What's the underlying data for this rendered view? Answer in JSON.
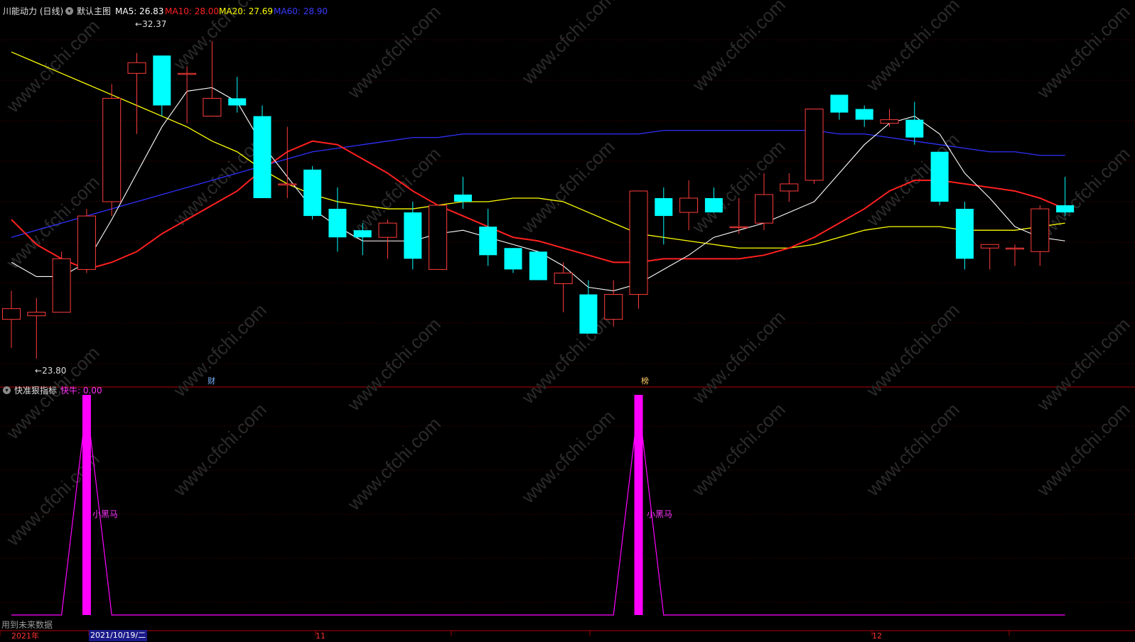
{
  "header": {
    "stock_title": "川能动力 (日线)",
    "main_chart_label": "默认主图",
    "ma5": "MA5: 26.83",
    "ma10": "MA10: 28.00",
    "ma20": "MA20: 27.69",
    "ma60": "MA60: 28.90"
  },
  "indicator_header": {
    "name": "快准狠指标",
    "value": "快牛: 0.00"
  },
  "annotations": {
    "high_price": "32.37",
    "low_price": "23.80",
    "event_cai": "财",
    "event_bang": "榜",
    "signal_label": "小黑马"
  },
  "footer": {
    "future_data_note": "用到未来数据",
    "year_label": "2021年",
    "selected_date": "2021/10/19/二",
    "month_11": "11",
    "month_12": "12"
  },
  "watermark": "www.cfchi.com",
  "colors": {
    "background": "#000000",
    "up": "#ff3c3c",
    "down": "#00ffff",
    "ma5": "#ffffff",
    "ma10": "#ff2020",
    "ma20": "#ffff00",
    "ma60": "#3030ff",
    "signal": "#ff00ff",
    "divider": "#b00000"
  },
  "chart_data": {
    "type": "candlestick",
    "price_range": [
      23.3,
      33.3
    ],
    "candles": [
      {
        "o": 24.9,
        "h": 25.7,
        "l": 24.1,
        "c": 25.2
      },
      {
        "o": 25.0,
        "h": 25.5,
        "l": 23.8,
        "c": 25.1
      },
      {
        "o": 25.1,
        "h": 26.8,
        "l": 25.1,
        "c": 26.6
      },
      {
        "o": 26.3,
        "h": 28.0,
        "l": 26.2,
        "c": 27.8
      },
      {
        "o": 28.2,
        "h": 31.5,
        "l": 27.8,
        "c": 31.1
      },
      {
        "o": 31.8,
        "h": 32.37,
        "l": 30.1,
        "c": 32.1
      },
      {
        "o": 32.3,
        "h": 32.3,
        "l": 30.6,
        "c": 30.9
      },
      {
        "o": 31.8,
        "h": 32.0,
        "l": 30.4,
        "c": 31.8
      },
      {
        "o": 30.6,
        "h": 32.7,
        "l": 30.7,
        "c": 31.1
      },
      {
        "o": 31.1,
        "h": 31.7,
        "l": 30.7,
        "c": 30.9
      },
      {
        "o": 30.6,
        "h": 30.9,
        "l": 28.3,
        "c": 28.3
      },
      {
        "o": 28.7,
        "h": 30.3,
        "l": 28.3,
        "c": 28.7
      },
      {
        "o": 29.1,
        "h": 29.2,
        "l": 27.7,
        "c": 27.8
      },
      {
        "o": 28.0,
        "h": 28.6,
        "l": 26.8,
        "c": 27.2
      },
      {
        "o": 27.4,
        "h": 27.6,
        "l": 26.7,
        "c": 27.2
      },
      {
        "o": 27.2,
        "h": 27.7,
        "l": 26.6,
        "c": 27.6
      },
      {
        "o": 27.9,
        "h": 28.2,
        "l": 26.3,
        "c": 26.6
      },
      {
        "o": 26.3,
        "h": 28.1,
        "l": 26.3,
        "c": 28.1
      },
      {
        "o": 28.4,
        "h": 28.9,
        "l": 28.0,
        "c": 28.2
      },
      {
        "o": 27.5,
        "h": 28.0,
        "l": 26.4,
        "c": 26.7
      },
      {
        "o": 26.9,
        "h": 26.9,
        "l": 26.2,
        "c": 26.3
      },
      {
        "o": 26.8,
        "h": 26.8,
        "l": 26.0,
        "c": 26.0
      },
      {
        "o": 25.9,
        "h": 26.5,
        "l": 25.1,
        "c": 26.2
      },
      {
        "o": 25.6,
        "h": 26.0,
        "l": 24.5,
        "c": 24.5
      },
      {
        "o": 24.9,
        "h": 26.0,
        "l": 24.7,
        "c": 25.6
      },
      {
        "o": 25.6,
        "h": 28.5,
        "l": 25.2,
        "c": 28.5
      },
      {
        "o": 28.3,
        "h": 28.6,
        "l": 27.0,
        "c": 27.8
      },
      {
        "o": 27.9,
        "h": 28.8,
        "l": 27.4,
        "c": 28.3
      },
      {
        "o": 28.3,
        "h": 28.6,
        "l": 27.9,
        "c": 27.9
      },
      {
        "o": 27.5,
        "h": 28.3,
        "l": 27.3,
        "c": 27.5
      },
      {
        "o": 27.6,
        "h": 29.0,
        "l": 27.4,
        "c": 28.4
      },
      {
        "o": 28.5,
        "h": 29.0,
        "l": 28.2,
        "c": 28.7
      },
      {
        "o": 28.8,
        "h": 30.5,
        "l": 28.7,
        "c": 30.8
      },
      {
        "o": 31.2,
        "h": 31.2,
        "l": 30.5,
        "c": 30.7
      },
      {
        "o": 30.8,
        "h": 30.9,
        "l": 30.3,
        "c": 30.5
      },
      {
        "o": 30.4,
        "h": 30.8,
        "l": 30.3,
        "c": 30.5
      },
      {
        "o": 30.5,
        "h": 31.0,
        "l": 29.8,
        "c": 30.0
      },
      {
        "o": 29.6,
        "h": 29.6,
        "l": 28.1,
        "c": 28.2
      },
      {
        "o": 28.0,
        "h": 28.2,
        "l": 26.3,
        "c": 26.6
      },
      {
        "o": 26.9,
        "h": 27.0,
        "l": 26.3,
        "c": 27.0
      },
      {
        "o": 26.9,
        "h": 27.0,
        "l": 26.4,
        "c": 26.9
      },
      {
        "o": 26.8,
        "h": 28.1,
        "l": 26.4,
        "c": 28.0
      },
      {
        "o": 28.1,
        "h": 28.9,
        "l": 27.8,
        "c": 27.9
      }
    ],
    "ma5": [
      26.5,
      26.1,
      26.1,
      26.5,
      27.7,
      29.0,
      30.3,
      31.3,
      31.4,
      31.0,
      29.8,
      28.9,
      28.0,
      27.5,
      27.1,
      27.1,
      27.1,
      27.3,
      27.4,
      27.2,
      27.0,
      26.8,
      26.4,
      25.8,
      25.7,
      25.9,
      26.3,
      26.7,
      27.2,
      27.4,
      27.6,
      27.9,
      28.2,
      29.0,
      29.8,
      30.4,
      30.6,
      30.1,
      29.0,
      28.3,
      27.5,
      27.2,
      27.1
    ],
    "ma10": [
      27.7,
      27.0,
      26.6,
      26.3,
      26.5,
      26.8,
      27.3,
      27.7,
      28.1,
      28.5,
      29.1,
      29.6,
      29.9,
      29.8,
      29.4,
      29.0,
      28.5,
      28.1,
      27.8,
      27.5,
      27.2,
      27.1,
      26.9,
      26.7,
      26.5,
      26.5,
      26.6,
      26.6,
      26.6,
      26.6,
      26.7,
      26.9,
      27.2,
      27.6,
      28.0,
      28.5,
      28.8,
      28.8,
      28.7,
      28.6,
      28.5,
      28.3,
      28.0
    ],
    "ma20": [
      32.4,
      32.1,
      31.8,
      31.5,
      31.2,
      30.9,
      30.6,
      30.3,
      29.9,
      29.6,
      29.1,
      28.7,
      28.4,
      28.2,
      28.1,
      28.0,
      28.0,
      28.1,
      28.2,
      28.2,
      28.3,
      28.3,
      28.2,
      27.9,
      27.6,
      27.3,
      27.2,
      27.1,
      27.0,
      26.9,
      26.9,
      26.9,
      27.0,
      27.2,
      27.4,
      27.5,
      27.5,
      27.5,
      27.4,
      27.4,
      27.4,
      27.5,
      27.6
    ],
    "ma60": [
      27.2,
      27.4,
      27.6,
      27.8,
      28.0,
      28.2,
      28.4,
      28.6,
      28.8,
      29.0,
      29.2,
      29.4,
      29.6,
      29.7,
      29.8,
      29.9,
      30.0,
      30.0,
      30.1,
      30.1,
      30.1,
      30.1,
      30.1,
      30.1,
      30.1,
      30.1,
      30.2,
      30.2,
      30.2,
      30.2,
      30.2,
      30.2,
      30.2,
      30.1,
      30.1,
      30.0,
      29.9,
      29.8,
      29.7,
      29.6,
      29.6,
      29.5,
      29.5
    ],
    "signal": [
      0,
      0,
      0,
      1,
      0,
      0,
      0,
      0,
      0,
      0,
      0,
      0,
      0,
      0,
      0,
      0,
      0,
      0,
      0,
      0,
      0,
      0,
      0,
      0,
      0,
      1,
      0,
      0,
      0,
      0,
      0,
      0,
      0,
      0,
      0,
      0,
      0,
      0,
      0,
      0,
      0,
      0,
      0
    ]
  }
}
